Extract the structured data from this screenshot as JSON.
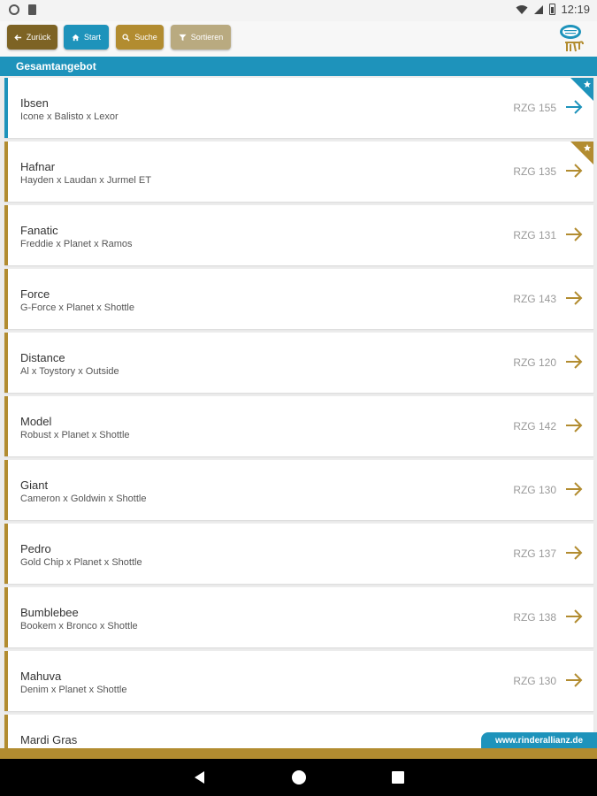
{
  "status_bar": {
    "time": "12:19",
    "icons": [
      "circle-notification-icon",
      "sd-card-icon",
      "wifi-icon",
      "cell-signal-icon",
      "battery-icon"
    ]
  },
  "toolbar": {
    "back_label": "Zurück",
    "start_label": "Start",
    "search_label": "Suche",
    "sort_label": "Sortieren"
  },
  "section": {
    "title": "Gesamtangebot"
  },
  "items": [
    {
      "name": "Ibsen",
      "pedigree": "Icone x Balisto x Lexor",
      "rzg": "RZG 155",
      "accent": "blue",
      "flagged": true
    },
    {
      "name": "Hafnar",
      "pedigree": "Hayden x Laudan x Jurmel ET",
      "rzg": "RZG 135",
      "accent": "gold",
      "flagged": true
    },
    {
      "name": "Fanatic",
      "pedigree": "Freddie x Planet x Ramos",
      "rzg": "RZG 131",
      "accent": "gold",
      "flagged": false
    },
    {
      "name": "Force",
      "pedigree": "G-Force x Planet x Shottle",
      "rzg": "RZG 143",
      "accent": "gold",
      "flagged": false
    },
    {
      "name": "Distance",
      "pedigree": "Al x Toystory x Outside",
      "rzg": "RZG 120",
      "accent": "gold",
      "flagged": false
    },
    {
      "name": "Model",
      "pedigree": "Robust x Planet x Shottle",
      "rzg": "RZG 142",
      "accent": "gold",
      "flagged": false
    },
    {
      "name": "Giant",
      "pedigree": "Cameron x Goldwin x Shottle",
      "rzg": "RZG 130",
      "accent": "gold",
      "flagged": false
    },
    {
      "name": "Pedro",
      "pedigree": "Gold Chip x Planet x Shottle",
      "rzg": "RZG 137",
      "accent": "gold",
      "flagged": false
    },
    {
      "name": "Bumblebee",
      "pedigree": "Bookem x Bronco x Shottle",
      "rzg": "RZG 138",
      "accent": "gold",
      "flagged": false
    },
    {
      "name": "Mahuva",
      "pedigree": "Denim x Planet x Shottle",
      "rzg": "RZG 130",
      "accent": "gold",
      "flagged": false
    },
    {
      "name": "Mardi Gras",
      "pedigree": "",
      "rzg": "",
      "accent": "gold",
      "flagged": false
    }
  ],
  "footer": {
    "url": "www.rinderallianz.de"
  },
  "colors": {
    "brand_blue": "#1e93bb",
    "brand_gold": "#b28c30",
    "brand_dark_gold": "#7d6324",
    "sort_button": "#b9aa80"
  }
}
